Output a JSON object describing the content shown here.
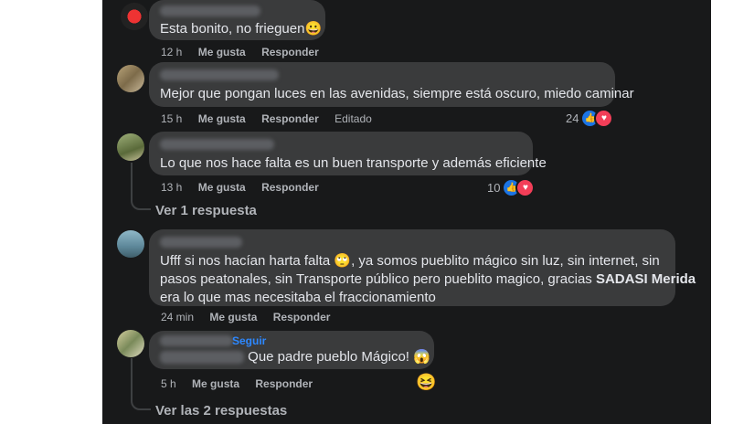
{
  "comments": [
    {
      "text": "Esta bonito, no frieguen😀",
      "time": "12 h",
      "like": "Me gusta",
      "reply": "Responder"
    },
    {
      "text": "Mejor que pongan luces en las avenidas, siempre está oscuro, miedo caminar",
      "time": "15 h",
      "like": "Me gusta",
      "reply": "Responder",
      "edited": "Editado",
      "reactions": "24"
    },
    {
      "text": "Lo que nos hace falta es un buen transporte y además eficiente",
      "time": "13 h",
      "like": "Me gusta",
      "reply": "Responder",
      "reactions": "10",
      "view_replies": "Ver 1 respuesta"
    },
    {
      "line1": "Ufff si nos hacían harta falta 🙄, ya somos pueblito mágico sin luz, sin internet, sin",
      "line2": "pasos peatonales, sin Transporte público pero pueblito magico, gracias ",
      "line2_bold": "SADASI Merida",
      "line3": "era lo que mas necesitaba el fraccionamiento",
      "time": "24 min",
      "like": "Me gusta",
      "reply": "Responder"
    },
    {
      "follow": "Seguir",
      "text": " Que padre pueblo Mágico! 😱",
      "time": "5 h",
      "like": "Me gusta",
      "reply": "Responder",
      "reaction_emoji": "😆",
      "view_replies": "Ver las 2 respuestas"
    }
  ],
  "icons": {
    "like": "like-icon",
    "love": "love-icon"
  }
}
